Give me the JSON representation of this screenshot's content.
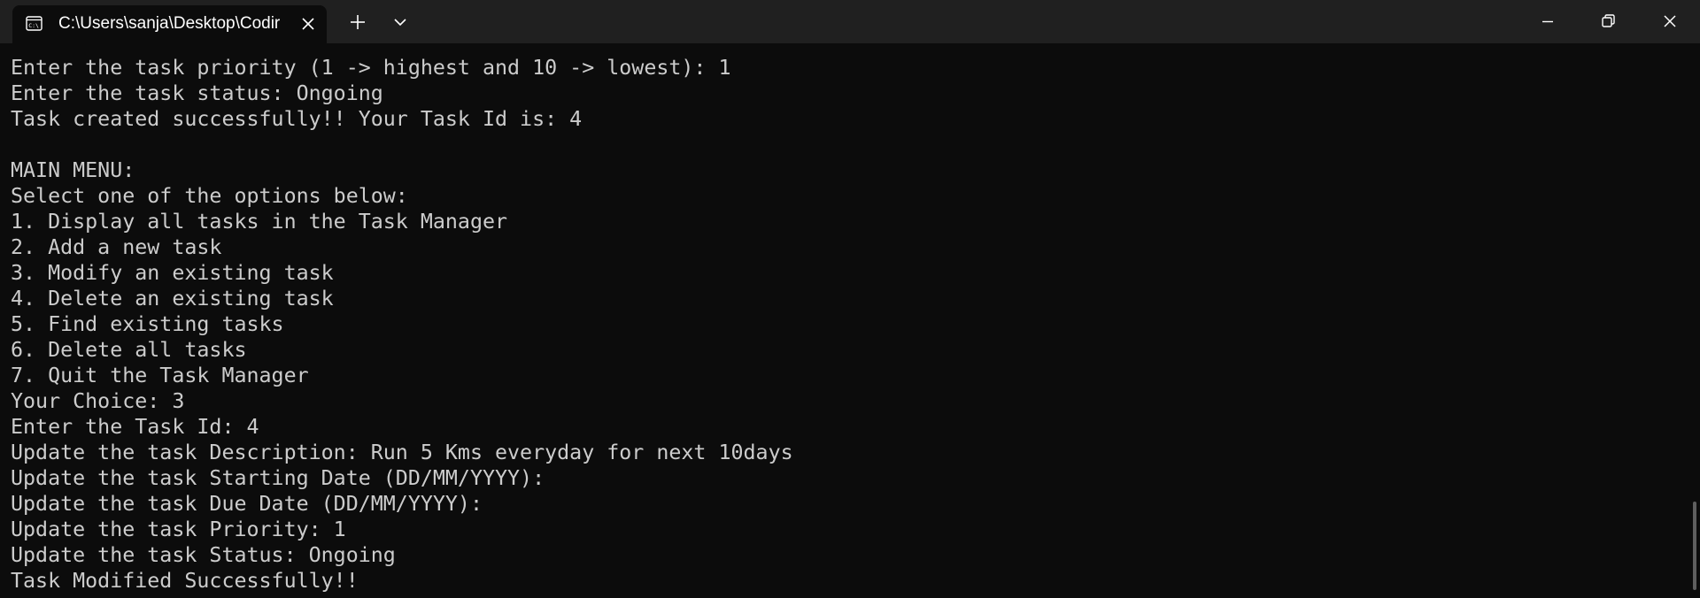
{
  "window": {
    "tab_title": "C:\\Users\\sanja\\Desktop\\Codir",
    "tab_icon": "terminal-icon",
    "new_tab_icon": "plus-icon",
    "dropdown_icon": "chevron-down-icon",
    "minimize_icon": "minimize-icon",
    "maximize_icon": "restore-icon",
    "close_icon": "close-icon",
    "colors": {
      "titlebar": "#202020",
      "console_background": "#0c0c0c",
      "console_text": "#cccccc"
    }
  },
  "console": {
    "lines": [
      "Enter the task priority (1 -> highest and 10 -> lowest): 1",
      "Enter the task status: Ongoing",
      "Task created successfully!! Your Task Id is: 4",
      "",
      "MAIN MENU:",
      "Select one of the options below:",
      "1. Display all tasks in the Task Manager",
      "2. Add a new task",
      "3. Modify an existing task",
      "4. Delete an existing task",
      "5. Find existing tasks",
      "6. Delete all tasks",
      "7. Quit the Task Manager",
      "Your Choice: 3",
      "Enter the Task Id: 4",
      "Update the task Description: Run 5 Kms everyday for next 10days",
      "Update the task Starting Date (DD/MM/YYYY):",
      "Update the task Due Date (DD/MM/YYYY):",
      "Update the task Priority: 1",
      "Update the task Status: Ongoing",
      "Task Modified Successfully!!"
    ]
  }
}
